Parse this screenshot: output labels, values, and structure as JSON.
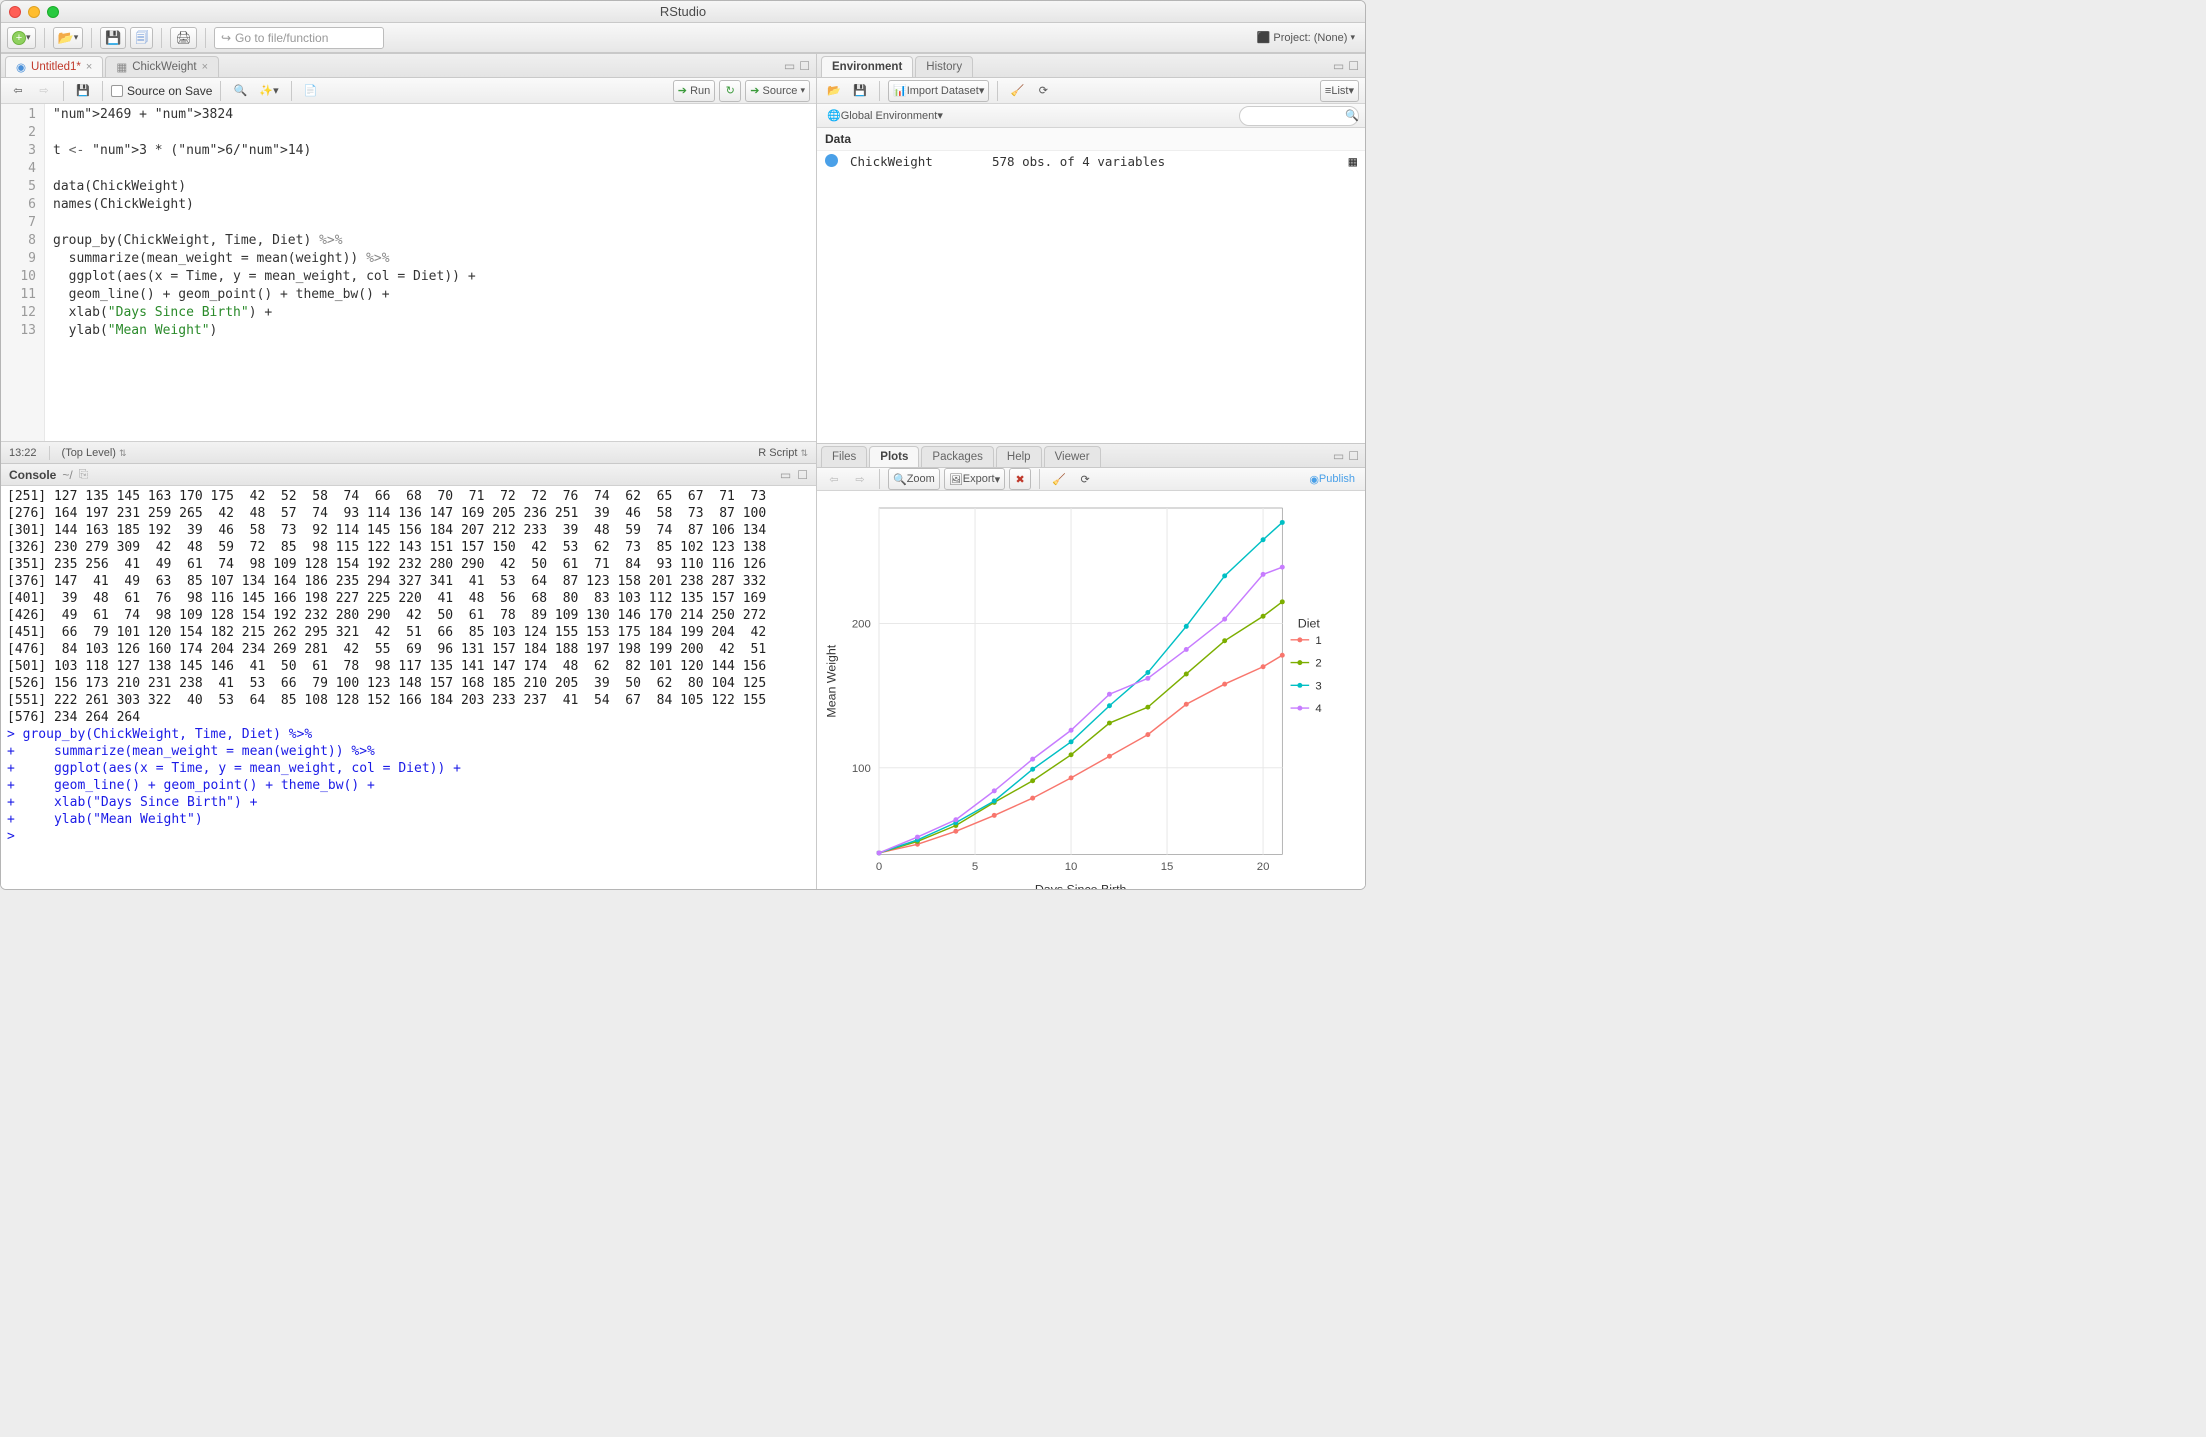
{
  "window": {
    "title": "RStudio"
  },
  "toolbar": {
    "project_label": "Project: (None)",
    "goto_placeholder": "Go to file/function"
  },
  "source": {
    "tabs": [
      {
        "label": "Untitled1*",
        "icon": "r-file"
      },
      {
        "label": "ChickWeight",
        "icon": "table"
      }
    ],
    "source_on_save": "Source on Save",
    "run_label": "Run",
    "source_label": "Source",
    "cursor": "13:22",
    "scope": "(Top Level)",
    "type": "R Script",
    "lines": [
      "2469 + 3824",
      "",
      "t <- 3 * (6/14)",
      "",
      "data(ChickWeight)",
      "names(ChickWeight)",
      "",
      "group_by(ChickWeight, Time, Diet) %>%",
      "  summarize(mean_weight = mean(weight)) %>%",
      "  ggplot(aes(x = Time, y = mean_weight, col = Diet)) +",
      "  geom_line() + geom_point() + theme_bw() +",
      "  xlab(\"Days Since Birth\") +",
      "  ylab(\"Mean Weight\")"
    ]
  },
  "console": {
    "title": "Console",
    "cwd": "~/",
    "output": "[251] 127 135 145 163 170 175  42  52  58  74  66  68  70  71  72  72  76  74  62  65  67  71  73\n[276] 164 197 231 259 265  42  48  57  74  93 114 136 147 169 205 236 251  39  46  58  73  87 100\n[301] 144 163 185 192  39  46  58  73  92 114 145 156 184 207 212 233  39  48  59  74  87 106 134\n[326] 230 279 309  42  48  59  72  85  98 115 122 143 151 157 150  42  53  62  73  85 102 123 138\n[351] 235 256  41  49  61  74  98 109 128 154 192 232 280 290  42  50  61  71  84  93 110 116 126\n[376] 147  41  49  63  85 107 134 164 186 235 294 327 341  41  53  64  87 123 158 201 238 287 332\n[401]  39  48  61  76  98 116 145 166 198 227 225 220  41  48  56  68  80  83 103 112 135 157 169\n[426]  49  61  74  98 109 128 154 192 232 280 290  42  50  61  78  89 109 130 146 170 214 250 272\n[451]  66  79 101 120 154 182 215 262 295 321  42  51  66  85 103 124 155 153 175 184 199 204  42\n[476]  84 103 126 160 174 204 234 269 281  42  55  69  96 131 157 184 188 197 198 199 200  42  51\n[501] 103 118 127 138 145 146  41  50  61  78  98 117 135 141 147 174  48  62  82 101 120 144 156\n[526] 156 173 210 231 238  41  53  66  79 100 123 148 157 168 185 210 205  39  50  62  80 104 125\n[551] 222 261 303 322  40  53  64  85 108 128 152 166 184 203 233 237  41  54  67  84 105 122 155\n[576] 234 264 264",
    "commands": [
      "group_by(ChickWeight, Time, Diet) %>%",
      "  summarize(mean_weight = mean(weight)) %>%",
      "  ggplot(aes(x = Time, y = mean_weight, col = Diet)) +",
      "  geom_line() + geom_point() + theme_bw() +",
      "  xlab(\"Days Since Birth\") +",
      "  ylab(\"Mean Weight\")"
    ]
  },
  "environment": {
    "tabs": [
      "Environment",
      "History"
    ],
    "import_label": "Import Dataset",
    "view_label": "List",
    "scope": "Global Environment",
    "section": "Data",
    "items": [
      {
        "name": "ChickWeight",
        "desc": "578 obs. of 4 variables"
      }
    ]
  },
  "plots": {
    "tabs": [
      "Files",
      "Plots",
      "Packages",
      "Help",
      "Viewer"
    ],
    "zoom_label": "Zoom",
    "export_label": "Export",
    "publish_label": "Publish"
  },
  "chart_data": {
    "type": "line",
    "title": "",
    "xlabel": "Days Since Birth",
    "ylabel": "Mean Weight",
    "legend_title": "Diet",
    "xlim": [
      0,
      21
    ],
    "ylim": [
      40,
      280
    ],
    "xticks": [
      0,
      5,
      10,
      15,
      20
    ],
    "yticks": [
      100,
      200
    ],
    "x": [
      0,
      2,
      4,
      6,
      8,
      10,
      12,
      14,
      16,
      18,
      20,
      21
    ],
    "series": [
      {
        "name": "1",
        "color": "#F8766D",
        "values": [
          41,
          47,
          56,
          67,
          79,
          93,
          108,
          123,
          144,
          158,
          170,
          178
        ]
      },
      {
        "name": "2",
        "color": "#7CAE00",
        "values": [
          41,
          49,
          60,
          76,
          91,
          109,
          131,
          142,
          165,
          188,
          205,
          215
        ]
      },
      {
        "name": "3",
        "color": "#00BFC4",
        "values": [
          41,
          50,
          62,
          77,
          99,
          118,
          143,
          166,
          198,
          233,
          258,
          270
        ]
      },
      {
        "name": "4",
        "color": "#C77CFF",
        "values": [
          41,
          52,
          64,
          84,
          106,
          126,
          151,
          162,
          182,
          203,
          234,
          239
        ]
      }
    ],
    "colors": {
      "1": "#F8766D",
      "2": "#7CAE00",
      "3": "#00BFC4",
      "4": "#C77CFF"
    }
  }
}
